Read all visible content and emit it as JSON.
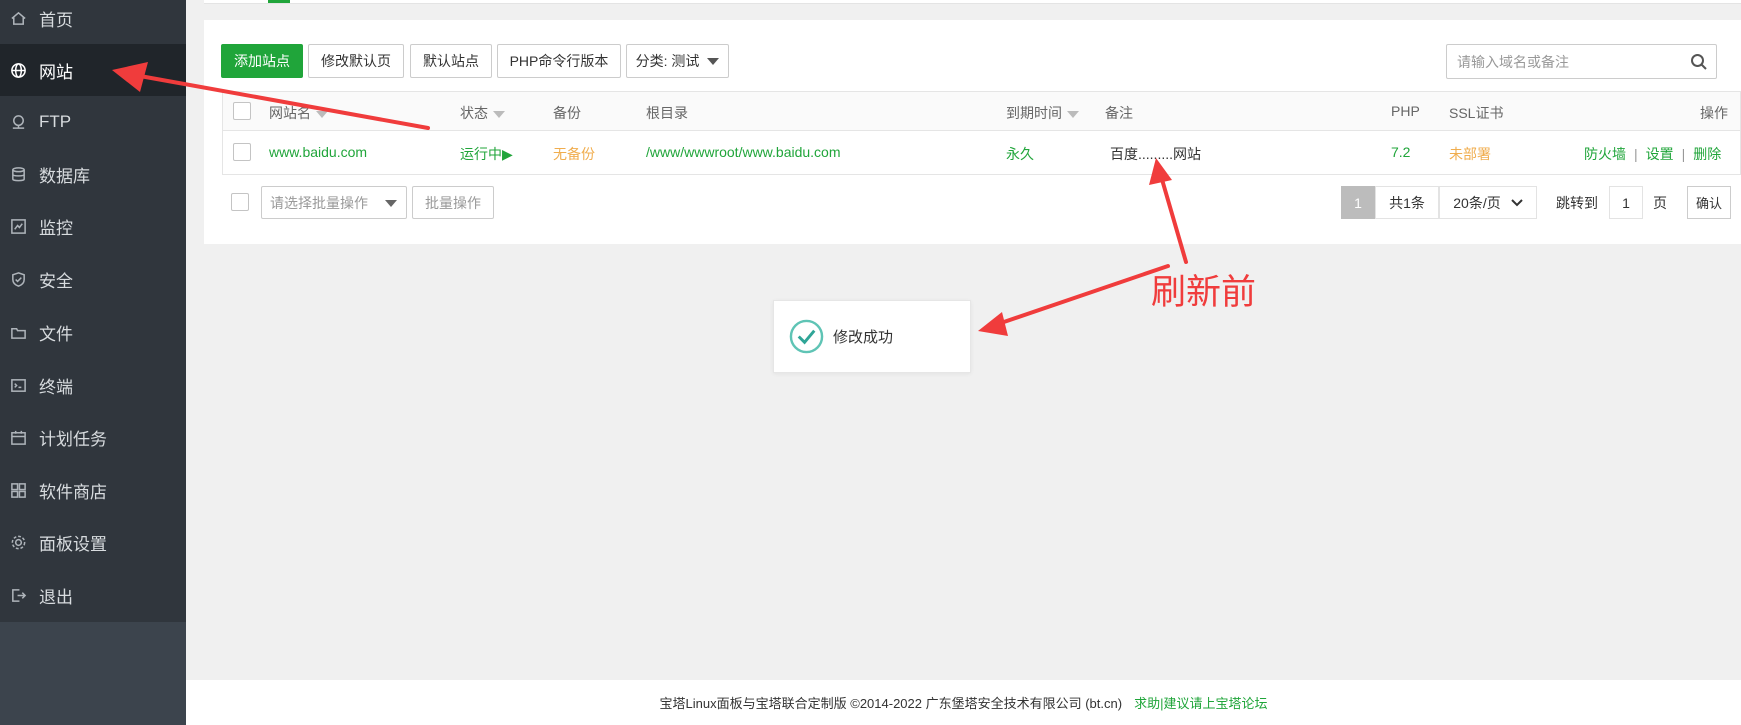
{
  "sidebar": {
    "items": [
      {
        "label": "首页",
        "icon": "home-icon"
      },
      {
        "label": "网站",
        "icon": "globe-icon",
        "active": true
      },
      {
        "label": "FTP",
        "icon": "ftp-icon"
      },
      {
        "label": "数据库",
        "icon": "database-icon"
      },
      {
        "label": "监控",
        "icon": "monitor-icon"
      },
      {
        "label": "安全",
        "icon": "shield-icon"
      },
      {
        "label": "文件",
        "icon": "folder-icon"
      },
      {
        "label": "终端",
        "icon": "terminal-icon"
      },
      {
        "label": "计划任务",
        "icon": "calendar-icon"
      },
      {
        "label": "软件商店",
        "icon": "grid-icon"
      },
      {
        "label": "面板设置",
        "icon": "gear-icon"
      },
      {
        "label": "退出",
        "icon": "logout-icon"
      }
    ]
  },
  "toolbar": {
    "add_site": "添加站点",
    "edit_default_page": "修改默认页",
    "default_site": "默认站点",
    "php_cli_version": "PHP命令行版本",
    "category": "分类: 测试"
  },
  "search": {
    "placeholder": "请输入域名或备注"
  },
  "table": {
    "headers": {
      "site": "网站名",
      "status": "状态",
      "backup": "备份",
      "root": "根目录",
      "expire": "到期时间",
      "note": "备注",
      "php": "PHP",
      "ssl": "SSL证书",
      "actions": "操作"
    },
    "rows": [
      {
        "site": "www.baidu.com",
        "status": "运行中▶",
        "backup": "无备份",
        "root": "/www/wwwroot/www.baidu.com",
        "expire": "永久",
        "note": "百度.........网站",
        "php": "7.2",
        "ssl": "未部署",
        "actions": {
          "firewall": "防火墙",
          "settings": "设置",
          "delete": "删除",
          "separator": "|"
        }
      }
    ]
  },
  "batch": {
    "placeholder": "请选择批量操作",
    "button": "批量操作"
  },
  "pagination": {
    "current": "1",
    "total": "共1条",
    "per_page": "20条/页",
    "jump_label": "跳转到",
    "jump_value": "1",
    "page_unit": "页",
    "confirm": "确认"
  },
  "toast": {
    "message": "修改成功"
  },
  "annotation": {
    "text": "刷新前",
    "color": "#f03c3c"
  },
  "footer": {
    "copyright": "宝塔Linux面板与宝塔联合定制版 ©2014-2022 广东堡塔安全技术有限公司 (bt.cn)",
    "link": "求助|建议请上宝塔论坛"
  },
  "colors": {
    "accent": "#20a53a",
    "warning": "#f0ad4e",
    "sidebar": "#30363d",
    "sidebar_active": "#20252a"
  }
}
